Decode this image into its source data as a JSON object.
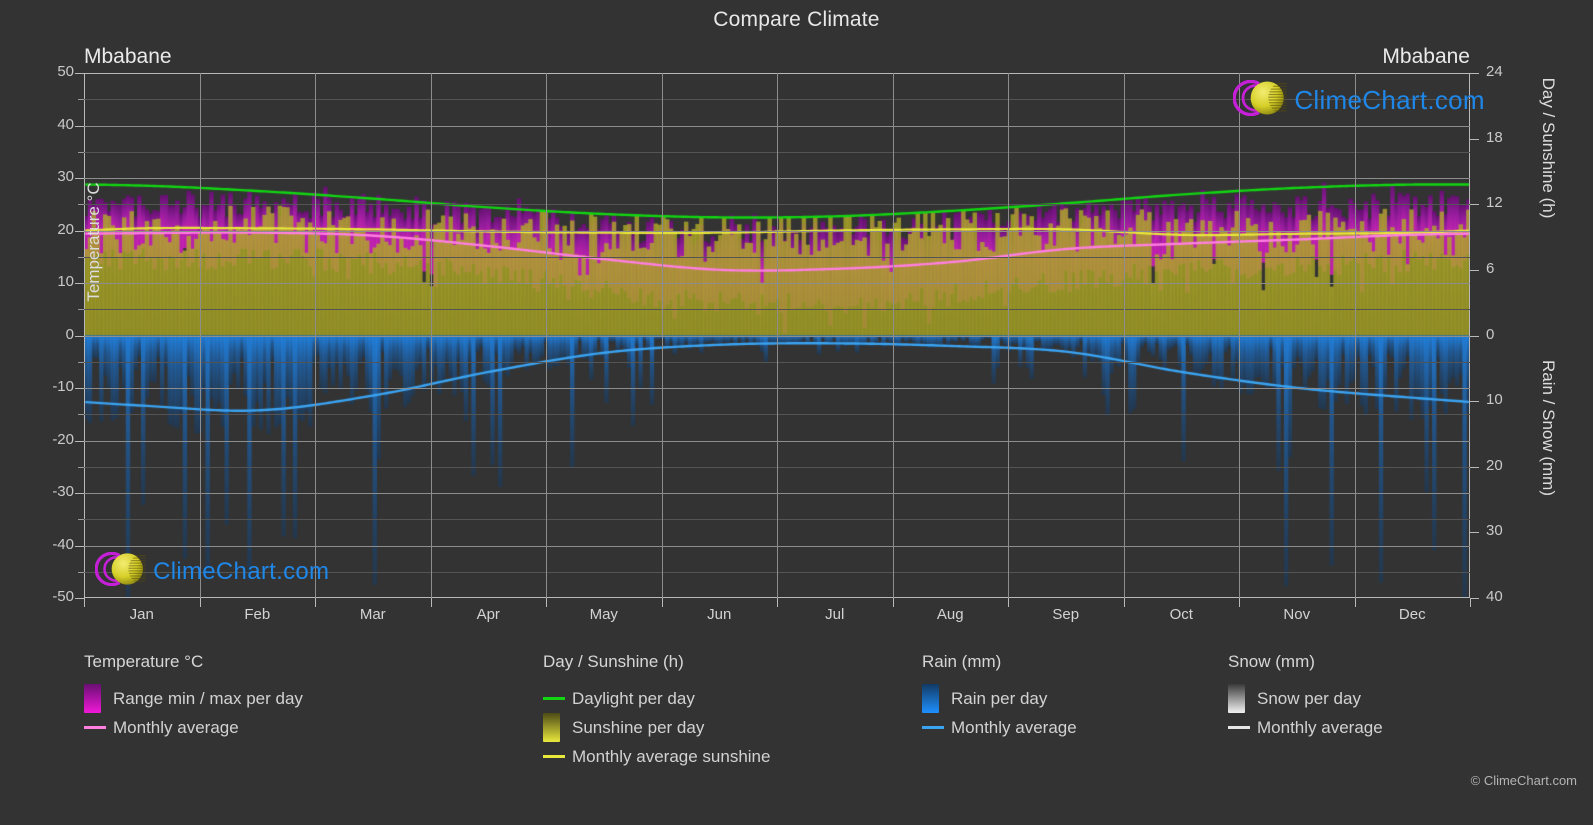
{
  "header": {
    "title": "Compare Climate",
    "city_left": "Mbabane",
    "city_right": "Mbabane"
  },
  "branding": {
    "logo_text": "ClimeChart.com",
    "copyright": "© ClimeChart.com",
    "logo_arc_color": "#c520d8",
    "logo_sphere_color": "#d6cf28",
    "logo_text_color": "#1f87e8"
  },
  "axes": {
    "left": {
      "label": "Temperature °C",
      "ticks": [
        "50",
        "40",
        "30",
        "20",
        "10",
        "0",
        "-10",
        "-20",
        "-30",
        "-40",
        "-50"
      ],
      "min": -50,
      "max": 50
    },
    "right_top": {
      "label": "Day / Sunshine (h)",
      "ticks": [
        "24",
        "18",
        "12",
        "6",
        "0"
      ],
      "min": 0,
      "max": 24
    },
    "right_bottom": {
      "label": "Rain / Snow (mm)",
      "ticks": [
        "0",
        "10",
        "20",
        "30",
        "40"
      ],
      "min": 0,
      "max": 40
    },
    "x": {
      "ticks": [
        "Jan",
        "Feb",
        "Mar",
        "Apr",
        "May",
        "Jun",
        "Jul",
        "Aug",
        "Sep",
        "Oct",
        "Nov",
        "Dec"
      ]
    }
  },
  "legend": {
    "groups": [
      {
        "title": "Temperature °C",
        "items": [
          {
            "label": "Range min / max per day",
            "style": "swatch",
            "color": "#f018d8",
            "color2": "#6a0f74"
          },
          {
            "label": "Monthly average",
            "style": "line",
            "color": "#ff7fe0"
          }
        ]
      },
      {
        "title": "Day / Sunshine (h)",
        "items": [
          {
            "label": "Daylight per day",
            "style": "line",
            "color": "#12d612"
          },
          {
            "label": "Sunshine per day",
            "style": "swatch",
            "color": "#e8e83c",
            "color2": "#4d4a16"
          },
          {
            "label": "Monthly average sunshine",
            "style": "line",
            "color": "#e8e83c"
          }
        ]
      },
      {
        "title": "Rain (mm)",
        "items": [
          {
            "label": "Rain per day",
            "style": "swatch",
            "color": "#1e90ff",
            "color2": "#123a63"
          },
          {
            "label": "Monthly average",
            "style": "line",
            "color": "#3ba4f2"
          }
        ]
      },
      {
        "title": "Snow (mm)",
        "items": [
          {
            "label": "Snow per day",
            "style": "swatch",
            "color": "#f2f2f2",
            "color2": "#3a3a3a"
          },
          {
            "label": "Monthly average",
            "style": "line",
            "color": "#e6e6e6"
          }
        ]
      }
    ]
  },
  "chart_data": {
    "type": "line",
    "title": "Compare Climate",
    "subtitle": "Mbabane",
    "xlabel": "",
    "ylabel": "Temperature °C",
    "grid": true,
    "legend_position": "below",
    "categories": [
      "Jan",
      "Feb",
      "Mar",
      "Apr",
      "May",
      "Jun",
      "Jul",
      "Aug",
      "Sep",
      "Oct",
      "Nov",
      "Dec"
    ],
    "axis_ranges": {
      "temperature_c": [
        -50,
        50
      ],
      "day_sunshine_h": [
        0,
        24
      ],
      "rain_snow_mm": [
        0,
        40
      ]
    },
    "series": [
      {
        "name": "Monthly average temperature",
        "unit": "°C",
        "color": "#ff7fe0",
        "axis": "temperature_c",
        "values": [
          19.5,
          19.6,
          19.0,
          17.0,
          14.5,
          12.5,
          12.7,
          14.0,
          16.5,
          17.5,
          18.3,
          19.2
        ]
      },
      {
        "name": "Daylight per day",
        "unit": "h",
        "color": "#12d612",
        "axis": "day_sunshine_h",
        "values": [
          13.7,
          13.2,
          12.5,
          11.7,
          11.1,
          10.8,
          10.9,
          11.4,
          12.1,
          12.9,
          13.5,
          13.8
        ]
      },
      {
        "name": "Monthly average sunshine",
        "unit": "h",
        "color": "#e8e83c",
        "axis": "day_sunshine_h",
        "values": [
          9.8,
          9.8,
          9.7,
          9.5,
          9.4,
          9.4,
          9.6,
          9.7,
          9.7,
          9.2,
          9.3,
          9.4
        ]
      },
      {
        "name": "Monthly average rain",
        "unit": "mm",
        "color": "#3ba4f2",
        "axis": "rain_snow_mm",
        "values": [
          10.7,
          11.4,
          9.1,
          5.5,
          2.6,
          1.4,
          1.2,
          1.6,
          2.5,
          5.6,
          8.0,
          9.5
        ]
      },
      {
        "name": "Temperature range min / max per day",
        "unit": "°C",
        "color": "#f018d8",
        "axis": "temperature_c",
        "min_values": [
          14.5,
          14.6,
          13.9,
          11.6,
          8.4,
          6.3,
          6.1,
          7.8,
          10.6,
          12.2,
          13.2,
          14.2
        ],
        "max_values": [
          25.0,
          25.1,
          24.4,
          22.6,
          20.7,
          19.2,
          19.4,
          21.0,
          23.3,
          24.2,
          24.4,
          25.0
        ]
      },
      {
        "name": "Snow per day",
        "unit": "mm",
        "color": "#f2f2f2",
        "axis": "rain_snow_mm",
        "values": [
          0,
          0,
          0,
          0,
          0,
          0,
          0,
          0,
          0,
          0,
          0,
          0
        ]
      }
    ]
  }
}
